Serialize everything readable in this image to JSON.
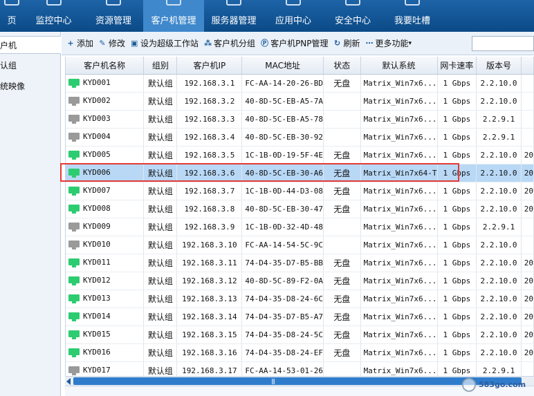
{
  "topnav": {
    "items": [
      {
        "label": "页",
        "active": false
      },
      {
        "label": "监控中心",
        "active": false
      },
      {
        "label": "资源管理",
        "active": false
      },
      {
        "label": "客户机管理",
        "active": true
      },
      {
        "label": "服务器管理",
        "active": false
      },
      {
        "label": "应用中心",
        "active": false
      },
      {
        "label": "安全中心",
        "active": false
      },
      {
        "label": "我要吐槽",
        "active": false
      }
    ]
  },
  "sidebar": {
    "items": [
      {
        "label": "户机"
      },
      {
        "label": "认组"
      },
      {
        "label": "统映像"
      }
    ]
  },
  "toolbar": {
    "buttons": [
      {
        "icon": "plus-icon",
        "label": "添加"
      },
      {
        "icon": "edit-icon",
        "label": "修改"
      },
      {
        "icon": "monitor-icon",
        "label": "设为超级工作站"
      },
      {
        "icon": "group-icon",
        "label": "客户机分组"
      },
      {
        "icon": "pnp-icon",
        "label": "客户机PNP管理"
      },
      {
        "icon": "refresh-icon",
        "label": "刷新"
      },
      {
        "icon": "more-icon",
        "label": "更多功能"
      }
    ]
  },
  "table": {
    "columns": [
      "客户机名称",
      "组别",
      "客户机IP",
      "MAC地址",
      "状态",
      "默认系统",
      "网卡速率",
      "版本号",
      ""
    ],
    "rows": [
      {
        "name": "KYD001",
        "online": true,
        "group": "默认组",
        "ip": "192.168.3.1",
        "mac": "FC-AA-14-20-26-BD",
        "status": "无盘",
        "system": "Matrix_Win7x6...",
        "speed": "1 Gbps",
        "version": "2.2.10.0",
        "extra": ""
      },
      {
        "name": "KYD002",
        "online": false,
        "group": "默认组",
        "ip": "192.168.3.2",
        "mac": "40-8D-5C-EB-A5-7A",
        "status": "",
        "system": "Matrix_Win7x6...",
        "speed": "1 Gbps",
        "version": "2.2.10.0",
        "extra": ""
      },
      {
        "name": "KYD003",
        "online": false,
        "group": "默认组",
        "ip": "192.168.3.3",
        "mac": "40-8D-5C-EB-A5-78",
        "status": "",
        "system": "Matrix_Win7x6...",
        "speed": "1 Gbps",
        "version": "2.2.9.1",
        "extra": ""
      },
      {
        "name": "KYD004",
        "online": false,
        "group": "默认组",
        "ip": "192.168.3.4",
        "mac": "40-8D-5C-EB-30-92",
        "status": "",
        "system": "Matrix_Win7x6...",
        "speed": "1 Gbps",
        "version": "2.2.9.1",
        "extra": ""
      },
      {
        "name": "KYD005",
        "online": true,
        "group": "默认组",
        "ip": "192.168.3.5",
        "mac": "1C-1B-0D-19-5F-4E",
        "status": "无盘",
        "system": "Matrix_Win7x6...",
        "speed": "1 Gbps",
        "version": "2.2.10.0",
        "extra": "20"
      },
      {
        "name": "KYD006",
        "online": true,
        "group": "默认组",
        "ip": "192.168.3.6",
        "mac": "40-8D-5C-EB-30-A6",
        "status": "无盘",
        "system": "Matrix_Win7x64-T",
        "speed": "1 Gbps",
        "version": "2.2.10.0",
        "extra": "20",
        "selected": true
      },
      {
        "name": "KYD007",
        "online": true,
        "group": "默认组",
        "ip": "192.168.3.7",
        "mac": "1C-1B-0D-44-D3-08",
        "status": "无盘",
        "system": "Matrix_Win7x6...",
        "speed": "1 Gbps",
        "version": "2.2.10.0",
        "extra": "20"
      },
      {
        "name": "KYD008",
        "online": true,
        "group": "默认组",
        "ip": "192.168.3.8",
        "mac": "40-8D-5C-EB-30-47",
        "status": "无盘",
        "system": "Matrix_Win7x6...",
        "speed": "1 Gbps",
        "version": "2.2.10.0",
        "extra": "20"
      },
      {
        "name": "KYD009",
        "online": false,
        "group": "默认组",
        "ip": "192.168.3.9",
        "mac": "1C-1B-0D-32-4D-48",
        "status": "",
        "system": "Matrix_Win7x6...",
        "speed": "1 Gbps",
        "version": "2.2.9.1",
        "extra": ""
      },
      {
        "name": "KYD010",
        "online": false,
        "group": "默认组",
        "ip": "192.168.3.10",
        "mac": "FC-AA-14-54-5C-9C",
        "status": "",
        "system": "Matrix_Win7x6...",
        "speed": "1 Gbps",
        "version": "2.2.10.0",
        "extra": ""
      },
      {
        "name": "KYD011",
        "online": true,
        "group": "默认组",
        "ip": "192.168.3.11",
        "mac": "74-D4-35-D7-B5-BB",
        "status": "无盘",
        "system": "Matrix_Win7x6...",
        "speed": "1 Gbps",
        "version": "2.2.10.0",
        "extra": "20"
      },
      {
        "name": "KYD012",
        "online": true,
        "group": "默认组",
        "ip": "192.168.3.12",
        "mac": "40-8D-5C-89-F2-0A",
        "status": "无盘",
        "system": "Matrix_Win7x6...",
        "speed": "1 Gbps",
        "version": "2.2.10.0",
        "extra": "20"
      },
      {
        "name": "KYD013",
        "online": true,
        "group": "默认组",
        "ip": "192.168.3.13",
        "mac": "74-D4-35-D8-24-6C",
        "status": "无盘",
        "system": "Matrix_Win7x6...",
        "speed": "1 Gbps",
        "version": "2.2.10.0",
        "extra": "20"
      },
      {
        "name": "KYD014",
        "online": true,
        "group": "默认组",
        "ip": "192.168.3.14",
        "mac": "74-D4-35-D7-B5-A7",
        "status": "无盘",
        "system": "Matrix_Win7x6...",
        "speed": "1 Gbps",
        "version": "2.2.10.0",
        "extra": "20"
      },
      {
        "name": "KYD015",
        "online": true,
        "group": "默认组",
        "ip": "192.168.3.15",
        "mac": "74-D4-35-D8-24-5C",
        "status": "无盘",
        "system": "Matrix_Win7x6...",
        "speed": "1 Gbps",
        "version": "2.2.10.0",
        "extra": "20"
      },
      {
        "name": "KYD016",
        "online": true,
        "group": "默认组",
        "ip": "192.168.3.16",
        "mac": "74-D4-35-D8-24-EF",
        "status": "无盘",
        "system": "Matrix_Win7x6...",
        "speed": "1 Gbps",
        "version": "2.2.10.0",
        "extra": "20"
      },
      {
        "name": "KYD017",
        "online": false,
        "group": "默认组",
        "ip": "192.168.3.17",
        "mac": "FC-AA-14-53-01-26",
        "status": "",
        "system": "Matrix_Win7x6...",
        "speed": "1 Gbps",
        "version": "2.2.9.1",
        "extra": ""
      }
    ]
  },
  "colors": {
    "online_pc": "#2ecc71",
    "offline_pc": "#9a9a9a",
    "selected_row": "#b8d8f6",
    "highlight_border": "#e53935",
    "nav_bg": "#0b4a87"
  },
  "watermark": {
    "text": "583go.com",
    "icon": "logo-icon"
  }
}
